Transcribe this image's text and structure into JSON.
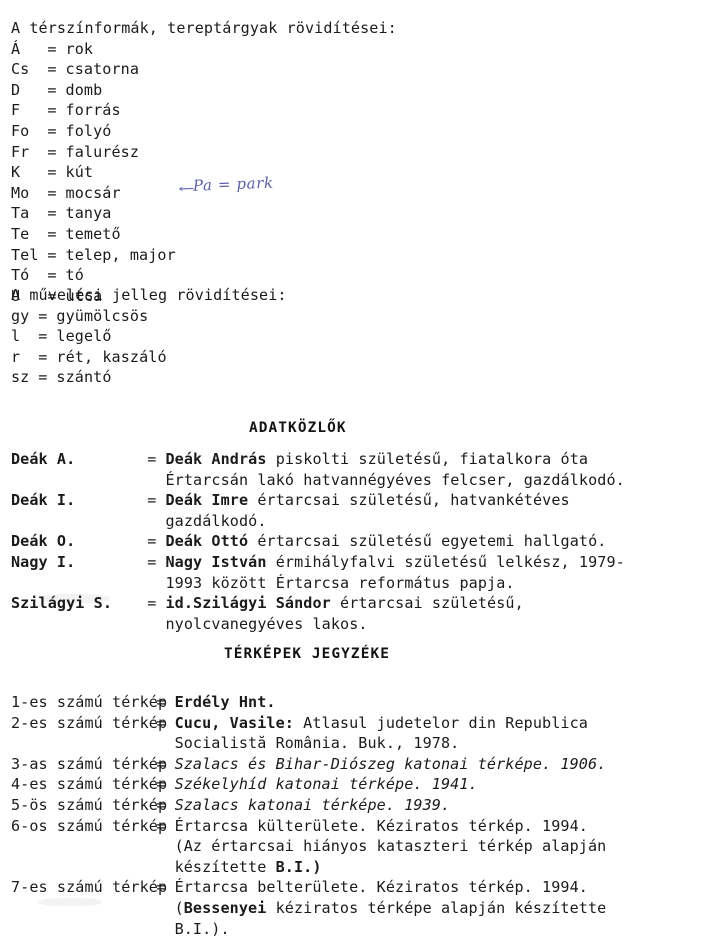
{
  "terrain": {
    "heading": "A térszínformák, tereptárgyak rövidítései:",
    "entries": [
      {
        "key": "Á",
        "value": "rok"
      },
      {
        "key": "Cs",
        "value": "csatorna"
      },
      {
        "key": "D",
        "value": "domb"
      },
      {
        "key": "F",
        "value": "forrás"
      },
      {
        "key": "Fo",
        "value": "folyó"
      },
      {
        "key": "Fr",
        "value": "falurész"
      },
      {
        "key": "K",
        "value": "kút"
      },
      {
        "key": "Mo",
        "value": "mocsár"
      },
      {
        "key": "Ta",
        "value": "tanya"
      },
      {
        "key": "Te",
        "value": "temető"
      },
      {
        "key": "Tel",
        "value": "telep, major"
      },
      {
        "key": "Tó",
        "value": "tó"
      },
      {
        "key": "U",
        "value": "utca"
      }
    ],
    "equals": "="
  },
  "handwriting": {
    "arrow": "←",
    "text": "Pa = park",
    "ink_color": "#5b5ea8"
  },
  "cultivation": {
    "heading": "A művelési jelleg rövidítései:",
    "entries": [
      {
        "key": "gy",
        "value": "gyümölcsös"
      },
      {
        "key": "l",
        "value": "legelő"
      },
      {
        "key": "r",
        "value": "rét, kaszáló"
      },
      {
        "key": "sz",
        "value": "szántó"
      }
    ],
    "equals": "="
  },
  "informants": {
    "heading": "ADATKÖZLŐK",
    "equals": "=",
    "entries": [
      {
        "key": "Deák A.",
        "name": "Deák András",
        "rest": " piskolti születésű, fiatalkora óta",
        "continuation": [
          "Értarcsán lakó hatvannégyéves felcser, gazdálkodó."
        ]
      },
      {
        "key": "Deák I.",
        "name": "Deák Imre",
        "rest": " értarcsai születésű, hatvankétéves",
        "continuation": [
          "gazdálkodó."
        ]
      },
      {
        "key": "Deák O.",
        "name": "Deák Ottó",
        "rest": " értarcsai születésű egyetemi hallgató.",
        "continuation": []
      },
      {
        "key": "Nagy I.",
        "name": "Nagy István",
        "rest": " érmihályfalvi születésű lelkész, 1979-",
        "continuation": [
          "1993 között Értarcsa református papja."
        ]
      },
      {
        "key": "Szilágyi S.",
        "name": "id.Szilágyi Sándor",
        "rest": " értarcsai születésű,",
        "continuation": [
          "nyolcvanegyéves lakos."
        ]
      }
    ]
  },
  "maps": {
    "heading": "TÉRKÉPEK JEGYZÉKE",
    "equals": "=",
    "entries": [
      {
        "label": "1-es számú térkép",
        "title_bold": "Erdély Hnt.",
        "title_rest": "",
        "style": "normal",
        "continuation": []
      },
      {
        "label": "2-es számú térkép",
        "title_bold": "Cucu, Vasile:",
        "title_rest": " Atlasul judetelor din Republica",
        "style": "normal",
        "continuation": [
          "Socialistă România. Buk., 1978."
        ]
      },
      {
        "label": "3-as számú térkép",
        "title_bold": "",
        "title_rest": "Szalacs és Bihar-Diószeg katonai térképe. 1906.",
        "style": "italic",
        "continuation": []
      },
      {
        "label": "4-es számú térkép",
        "title_bold": "",
        "title_rest": "Székelyhíd katonai térképe. 1941.",
        "style": "italic",
        "continuation": []
      },
      {
        "label": "5-ös számú térkép",
        "title_bold": "",
        "title_rest": "Szalacs katonai térképe. 1939.",
        "style": "italic",
        "continuation": []
      },
      {
        "label": "6-os számú térkép",
        "title_bold": "",
        "title_rest": "Értarcsa külterülete. Kéziratos térkép. 1994.",
        "style": "normal",
        "continuation": [
          "(Az értarcsai hiányos kataszteri térkép alapján",
          "készítette B.I.)"
        ]
      },
      {
        "label": "7-es számú térkép",
        "title_bold": "",
        "title_rest": "Értarcsa belterülete. Kéziratos térkép. 1994.",
        "style": "normal",
        "continuation": [
          "(Bessenyei kéziratos térképe alapján készítette",
          "B.I.)."
        ]
      }
    ]
  }
}
